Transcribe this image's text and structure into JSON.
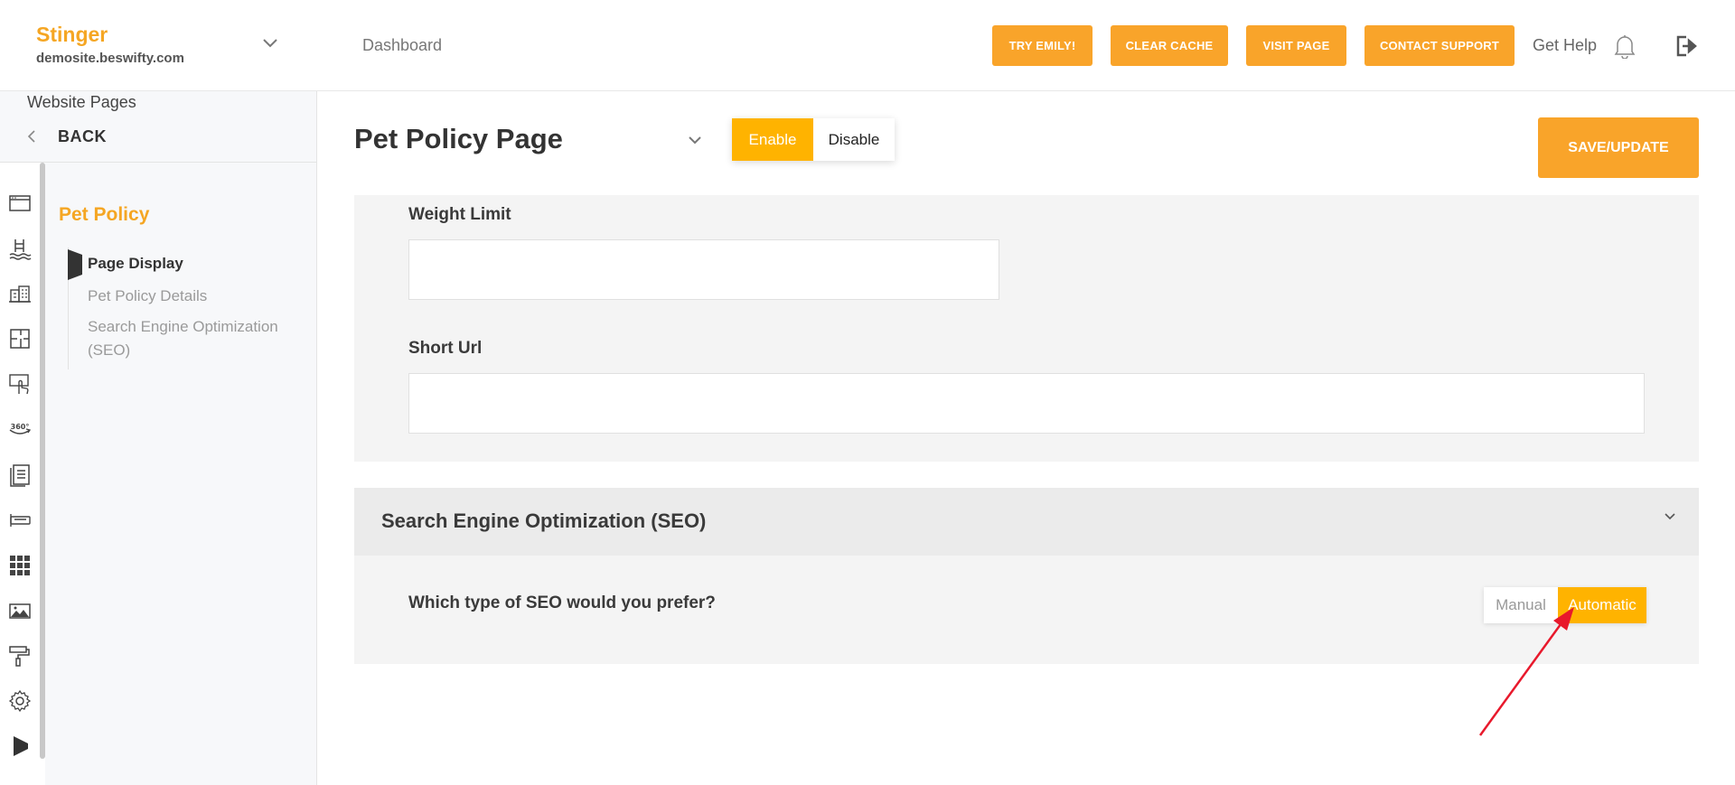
{
  "brand": {
    "name": "Stinger",
    "domain": "demosite.beswifty.com"
  },
  "sidebar": {
    "section_label": "Website Pages",
    "back_label": "BACK",
    "nav_title": "Pet Policy",
    "items": [
      {
        "label": "Page Display",
        "active": true
      },
      {
        "label": "Pet Policy Details",
        "active": false
      },
      {
        "label": "Search Engine Optimization (SEO)",
        "active": false
      }
    ],
    "rail_icons": [
      "browser-window-icon",
      "pool-icon",
      "buildings-icon",
      "floorplan-icon",
      "touch-screen-icon",
      "360-view-icon",
      "documents-icon",
      "key-card-icon",
      "grid-apps-icon",
      "image-gallery-icon",
      "paint-roller-icon",
      "gear-icon",
      "flag-icon"
    ]
  },
  "header": {
    "breadcrumb": "Dashboard",
    "buttons": {
      "try_emily": "TRY EMILY!",
      "clear_cache": "CLEAR CACHE",
      "visit_page": "VISIT PAGE",
      "contact_support": "CONTACT SUPPORT"
    },
    "get_help": "Get Help"
  },
  "main": {
    "page_title": "Pet Policy Page",
    "toggle": {
      "enable": "Enable",
      "disable": "Disable",
      "selected": "Enable"
    },
    "save_label": "SAVE/UPDATE",
    "fields": {
      "weight_limit": {
        "label": "Weight Limit",
        "value": ""
      },
      "short_url": {
        "label": "Short Url",
        "value": ""
      }
    },
    "seo": {
      "title": "Search Engine Optimization (SEO)",
      "question": "Which type of SEO would you prefer?",
      "manual": "Manual",
      "automatic": "Automatic",
      "selected": "Automatic"
    }
  },
  "colors": {
    "accent": "#f9a42a",
    "toggle_on": "#ffb300",
    "annotation_arrow": "#e8192c"
  }
}
